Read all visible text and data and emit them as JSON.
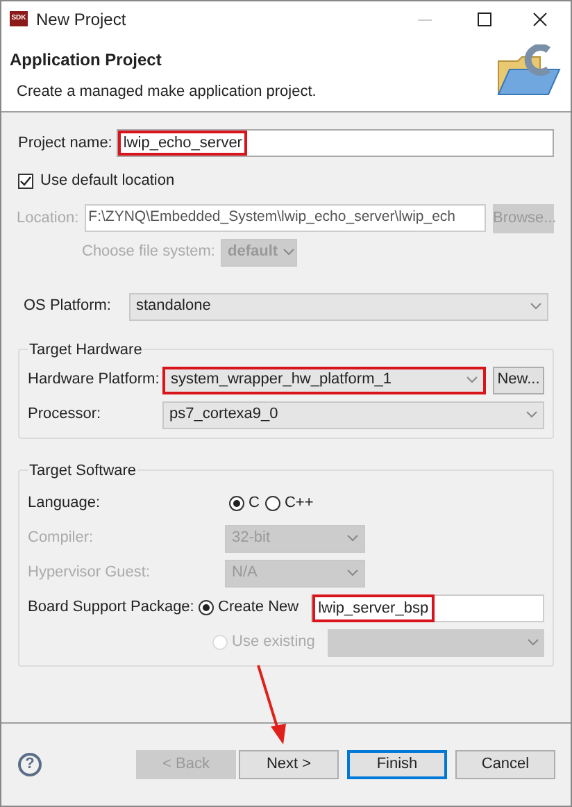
{
  "window": {
    "title": "New Project",
    "icon_text": "SDK"
  },
  "header": {
    "title": "Application Project",
    "description": "Create a managed make application project."
  },
  "project_name": {
    "label": "Project name:",
    "value": "lwip_echo_server",
    "highlighted": true
  },
  "use_default_location": {
    "label": "Use default location",
    "checked": true
  },
  "location": {
    "label": "Location:",
    "value": "F:\\ZYNQ\\Embedded_System\\lwip_echo_server\\lwip_ech",
    "disabled": true,
    "button": "Browse..."
  },
  "file_system": {
    "label": "Choose file system:",
    "value": "default",
    "disabled": true
  },
  "os_platform": {
    "label": "OS Platform:",
    "value": "standalone"
  },
  "target_hardware": {
    "title": "Target Hardware",
    "rows": [
      {
        "label": "Hardware Platform:",
        "value": "system_wrapper_hw_platform_1",
        "highlighted": true,
        "button": "New..."
      },
      {
        "label": "Processor:",
        "value": "ps7_cortexa9_0",
        "highlighted": false
      }
    ]
  },
  "target_software": {
    "title": "Target Software",
    "rows": [
      {
        "kind": "radios",
        "label": "Language:",
        "options": [
          {
            "label": "C",
            "selected": true
          },
          {
            "label": "C++",
            "selected": false
          }
        ]
      },
      {
        "kind": "select",
        "label": "Compiler:",
        "value": "32-bit",
        "disabled": true
      },
      {
        "kind": "select",
        "label": "Hypervisor Guest:",
        "value": "N/A",
        "disabled": true
      },
      {
        "kind": "radio_text",
        "label": "Board Support Package:",
        "option": {
          "label": "Create New",
          "selected": true,
          "disabled": false
        },
        "value": "lwip_server_bsp",
        "highlighted": true
      },
      {
        "kind": "radio_select",
        "option": {
          "label": "Use existing",
          "selected": false,
          "disabled": true
        },
        "disabled": true
      }
    ]
  },
  "help": "?",
  "buttons": [
    {
      "label": "< Back",
      "disabled": true,
      "default": false
    },
    {
      "label": "Next >",
      "disabled": false,
      "default": false
    },
    {
      "label": "Finish",
      "disabled": false,
      "default": true
    },
    {
      "label": "Cancel",
      "disabled": false,
      "default": false
    }
  ],
  "annotation_arrow": true
}
